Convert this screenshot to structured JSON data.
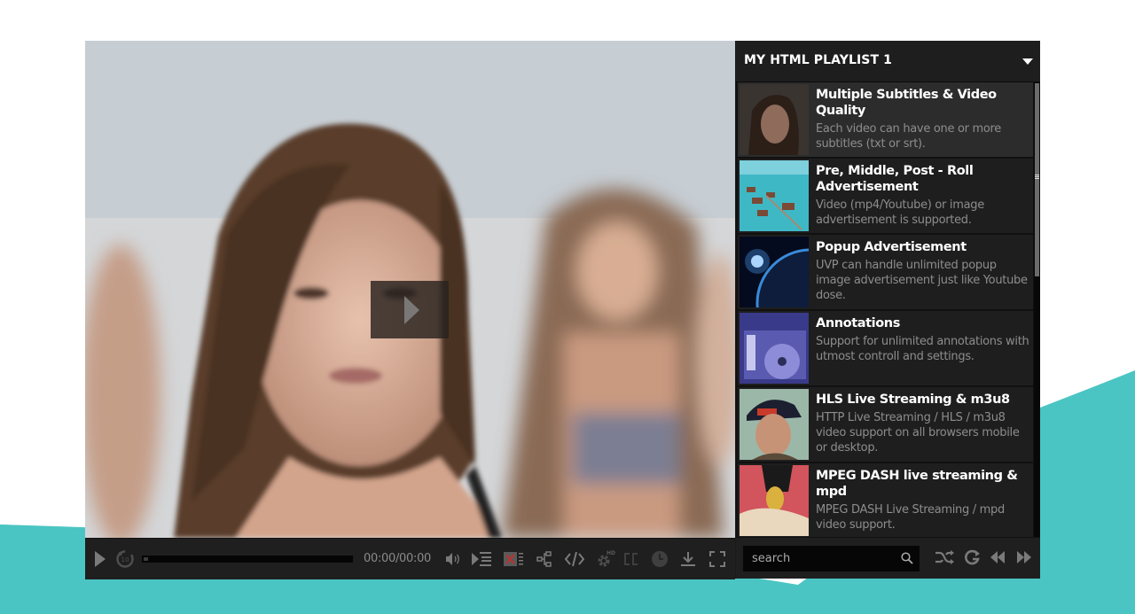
{
  "colors": {
    "accent_teal": "#4ac5c3",
    "player_bg": "#1b1b1b",
    "icon_gray": "#7a7a7a"
  },
  "player": {
    "big_play_icon": "play-icon",
    "controls": {
      "play_icon": "play-icon",
      "replay_icon": "replay-10-icon",
      "progress_percent": 2,
      "time": "00:00/00:00",
      "volume_icon": "volume-icon",
      "playlist_icon": "playlist-icon",
      "subtitles_off_icon": "subtitles-off-icon",
      "share_icon": "share-icon",
      "embed_icon": "embed-code-icon",
      "quality_icon": "quality-hd-gear-icon",
      "quality_badge": "HD",
      "captions_icon": "captions-icon",
      "captions_label": "CC",
      "speed_icon": "clock-icon",
      "download_icon": "download-icon",
      "fullscreen_icon": "fullscreen-icon"
    }
  },
  "playlist": {
    "title": "MY HTML PLAYLIST 1",
    "toggle_icon": "caret-down-icon",
    "items": [
      {
        "title": "Multiple Subtitles & Video Quality",
        "description": "Each video can have one or more subtitles (txt or srt).",
        "active": true
      },
      {
        "title": "Pre, Middle, Post - Roll Advertisement",
        "description": "Video (mp4/Youtube) or image advertisement is supported.",
        "active": false
      },
      {
        "title": "Popup Advertisement",
        "description": "UVP can handle unlimited popup image advertisement just like Youtube dose.",
        "active": false
      },
      {
        "title": "Annotations",
        "description": "Support for unlimited annotations with utmost controll and settings.",
        "active": false
      },
      {
        "title": "HLS Live Streaming & m3u8",
        "description": "HTTP Live Streaming / HLS / m3u8 video support on all browsers mobile or desktop.",
        "active": false
      },
      {
        "title": "MPEG DASH live streaming & mpd",
        "description": "MPEG DASH Live Streaming / mpd video support.",
        "active": false
      }
    ],
    "search": {
      "placeholder": "search",
      "value": ""
    },
    "controls": {
      "shuffle_icon": "shuffle-icon",
      "loop_icon": "loop-icon",
      "previous_icon": "previous-icon",
      "next_icon": "next-icon"
    }
  }
}
